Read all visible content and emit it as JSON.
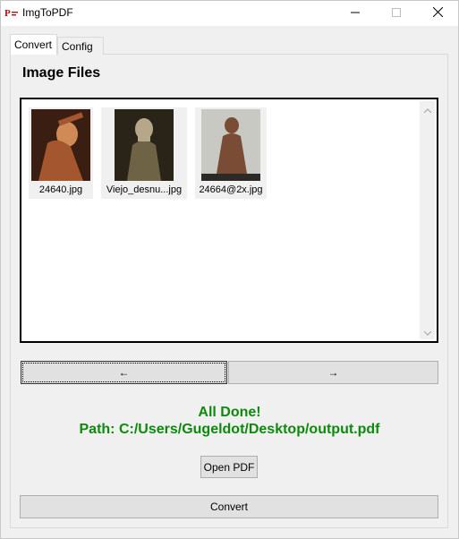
{
  "window": {
    "title": "ImgToPDF",
    "icon": "app-logo-icon",
    "controls": [
      "minimize-icon",
      "maximize-icon",
      "close-icon"
    ]
  },
  "tabs": [
    {
      "label": "Convert",
      "active": true
    },
    {
      "label": "Config",
      "active": false
    }
  ],
  "section_title": "Image Files",
  "files": [
    {
      "name": "24640.jpg",
      "palette": [
        "#3a1e12",
        "#a4562e",
        "#d08a55"
      ]
    },
    {
      "name": "Viejo_desnu...jpg",
      "palette": [
        "#2a2418",
        "#6f6346",
        "#b7a78a"
      ]
    },
    {
      "name": "24664@2x.jpg",
      "palette": [
        "#c9c9c3",
        "#7a4c36",
        "#2c2a26"
      ]
    }
  ],
  "nav": {
    "prev_label": "←",
    "next_label": "→"
  },
  "status": {
    "done": "All Done!",
    "path": "Path:  C:/Users/Gugeldot/Desktop/output.pdf",
    "color": "#0b8a0b"
  },
  "buttons": {
    "open_pdf": "Open PDF",
    "convert": "Convert"
  }
}
